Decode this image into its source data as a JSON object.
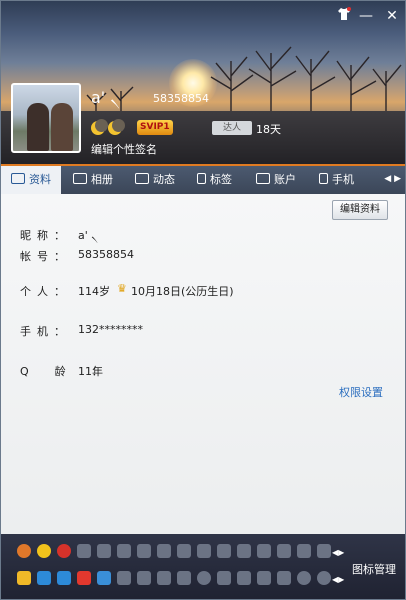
{
  "window": {
    "title_icons": [
      "shirt-icon",
      "minimize-icon",
      "close-icon"
    ],
    "minimize_glyph": "—",
    "close_glyph": "✕"
  },
  "profile": {
    "nickname": "a' ৲",
    "account_number": "58358854",
    "level_icons": [
      "moon-icon",
      "moon-icon"
    ],
    "vip_badge": "SVIP1",
    "talent_badge": "达人",
    "active_days": "18天",
    "signature": "编辑个性签名"
  },
  "tabs": [
    {
      "label": "资料",
      "icon": "profile-card-icon",
      "active": true
    },
    {
      "label": "相册",
      "icon": "photo-album-icon",
      "active": false
    },
    {
      "label": "动态",
      "icon": "feed-icon",
      "active": false
    },
    {
      "label": "标签",
      "icon": "bookmark-icon",
      "active": false
    },
    {
      "label": "账户",
      "icon": "briefcase-icon",
      "active": false
    },
    {
      "label": "手机",
      "icon": "phone-icon",
      "active": false
    }
  ],
  "edit_button": "编辑资料",
  "info": {
    "nickname_label": "昵称：",
    "nickname_value": "a' ৲",
    "account_label": "帐号：",
    "account_value": "58358854",
    "personal_label": "个人：",
    "age": "114岁",
    "birthday": "10月18日(公历生日)",
    "phone_label": "手机：",
    "phone_value": "132********",
    "qage_label": "Q龄：",
    "qage_value": "11年"
  },
  "permission_link": "权限设置",
  "icon_manager": "图标管理",
  "colors": {
    "accent_orange": "#e07b22",
    "link_blue": "#2c6fbf",
    "tab_active_text": "#2a5a96"
  }
}
